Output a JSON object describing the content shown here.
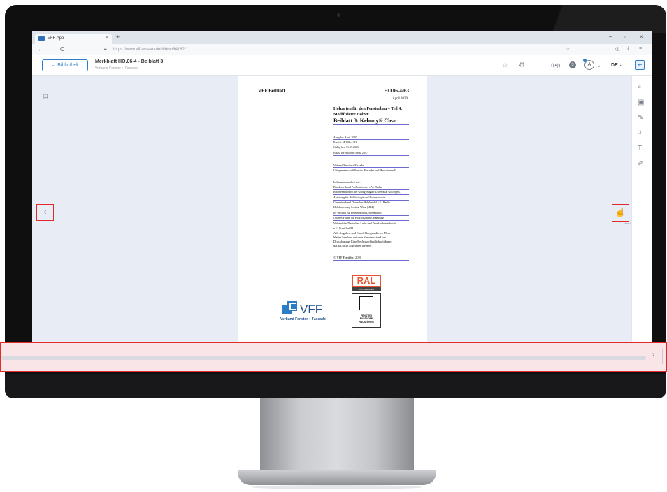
{
  "browser": {
    "tab_title": "VFF App",
    "tab_close": "×",
    "new_tab": "+",
    "url": "https://www.vff-wissen.de/#/doc/64162/1",
    "back": "←",
    "forward": "→",
    "reload": "C",
    "window_minimize": "–",
    "window_maximize": "▫",
    "window_close": "×"
  },
  "header": {
    "back_label": "← Bibliothek",
    "doc_title": "Merkblatt HO.06-4 - Beiblatt 3",
    "doc_subtitle": "Verband Fenster + Fassade",
    "notification_count": "3",
    "avatar_letter": "A",
    "language": "DE⌄"
  },
  "viewer": {
    "prev_label": "‹",
    "hand_label": "Hand"
  },
  "document": {
    "header_left": "VFF Beiblatt",
    "header_right": "HO.06-4/B3",
    "date": "April 2020",
    "title_line1": "Holzarten für den Fensterbau – Teil 4:",
    "title_line2": "Modifizierte Hölzer",
    "title_main": "Beiblatt 3: Kebony® Clear",
    "info_lines": [
      "Ausgabe: April 2020",
      "Ersetzt: HO.06-4/B3",
      "Gültig bis: 31.03.2025",
      "Ersatz für Ausgabe März 2017"
    ],
    "publisher_lines": [
      "Verband Fenster + Fassade",
      "Gütegemeinschaft Fenster, Fassaden und Haustüren e.V."
    ],
    "partner_lines": [
      "In Zusammenarbeit mit:",
      "Bundesverband ProHolzfenster e.V., Berlin",
      "Büchsenmacherei der Georg-August-Universität Göttingen,",
      "Abteilung für Holzbiologie und Holzprodukte",
      "Gesamtverband Deutscher Holzhandel e.V., Berlin",
      "Holzforschung Austria, Wien (HFA)",
      "ift - Institut für Fenstertechnik, Rosenheim",
      "Offenes Forum für Holzforschung, Hamburg",
      "Verband der Deutschen Lack- und Druckfarbenindustrie",
      "e.V., Frankfurt/M."
    ],
    "disclaimer_lines": [
      "Alle Angaben und Empfehlungen dieses Merk-",
      "blattes beruhen auf dem Kenntnisstand bei",
      "Drucklegung. Eine Rechtsverbindlichkeit kann",
      "daraus nicht abgeleitet werden."
    ],
    "copyright": "© VFF Frankfurt 2020",
    "ral_label": "RAL",
    "ral_sub": "GÜTEZEICHEN",
    "ral_text_lines": [
      "FENSTER",
      "FASSADEN",
      "HAUSTÜREN"
    ],
    "vff_brand": "VFF",
    "vff_tagline": "Verband Fenster + Fassade"
  },
  "scrollbar": {
    "arrow": "›"
  },
  "colors": {
    "accent": "#2f7ec9",
    "highlight_border": "#e22a2a",
    "doc_rule": "#6a6ad0",
    "ral_orange": "#e8542f",
    "vff_blue": "#2b7dc5"
  },
  "icons": {
    "bookmark": "bookmark-icon",
    "zoom": "zoom-icon",
    "hand": "hand-icon",
    "star": "star-icon",
    "settings": "gear-icon",
    "broadcast": "broadcast-icon",
    "pencil": "pencil-icon"
  }
}
